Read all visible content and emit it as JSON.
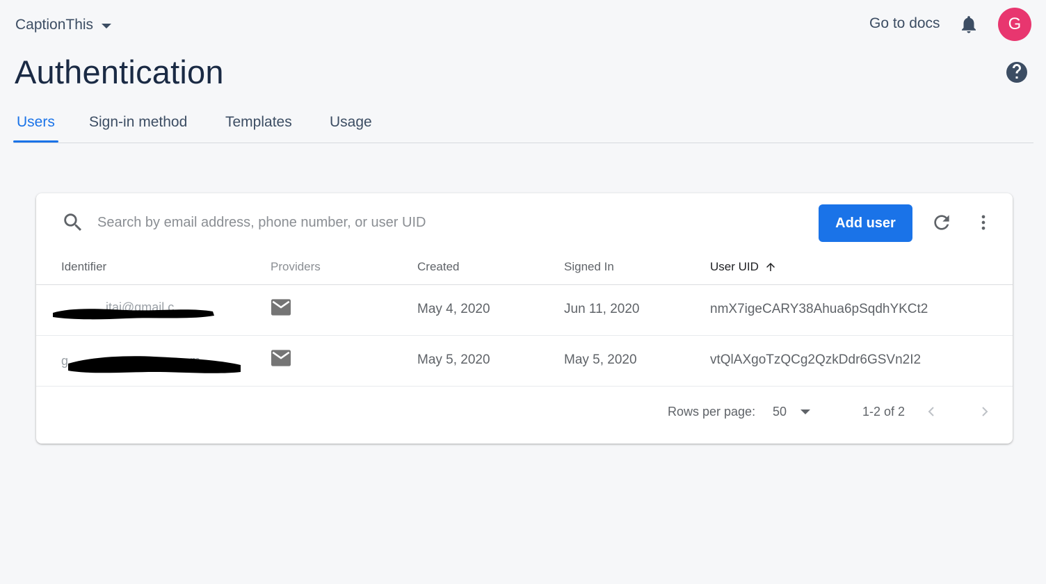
{
  "header": {
    "project_name": "CaptionThis",
    "go_to_docs": "Go to docs",
    "avatar_letter": "G",
    "avatar_color": "#e8366f"
  },
  "page": {
    "title": "Authentication"
  },
  "tabs": [
    {
      "label": "Users",
      "active": true
    },
    {
      "label": "Sign-in method",
      "active": false
    },
    {
      "label": "Templates",
      "active": false
    },
    {
      "label": "Usage",
      "active": false
    }
  ],
  "toolbar": {
    "search_placeholder": "Search by email address, phone number, or user UID",
    "add_user_label": "Add user"
  },
  "table": {
    "columns": [
      "Identifier",
      "Providers",
      "Created",
      "Signed In",
      "User UID"
    ],
    "sorted_column": "User UID",
    "sort_direction": "ascending",
    "rows": [
      {
        "identifier_visible": "itai@gmail.c",
        "provider_icon": "email-icon",
        "created": "May 4, 2020",
        "signed_in": "Jun 11, 2020",
        "uid": "nmX7igeCARY38Ahua6pSqdhYKCt2"
      },
      {
        "identifier_visible": "g                                   m",
        "provider_icon": "email-icon",
        "created": "May 5, 2020",
        "signed_in": "May 5, 2020",
        "uid": "vtQlAXgoTzQCg2QzkDdr6GSVn2I2"
      }
    ]
  },
  "pagination": {
    "rows_per_page_label": "Rows per page:",
    "rows_per_page": "50",
    "range": "1-2 of 2"
  },
  "colors": {
    "accent": "#1a73e8",
    "title": "#1a2a44",
    "background": "#f6f7f9"
  }
}
